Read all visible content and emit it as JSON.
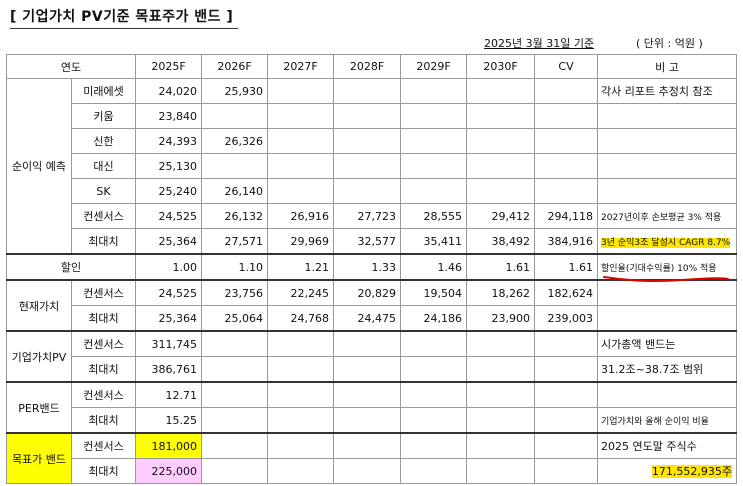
{
  "title": "[ 기업가치 PV기준 목표주가 밴드 ]",
  "base_date": "2025년 3월 31일 기준",
  "unit": "( 단위 : 억원 )",
  "headers": [
    "연도",
    "2025F",
    "2026F",
    "2027F",
    "2028F",
    "2029F",
    "2030F",
    "CV",
    "비 고"
  ],
  "net_income": {
    "group": "순이익 예측",
    "rows": [
      {
        "label": "미래에셋",
        "values": [
          "24,020",
          "25,930",
          "",
          "",
          "",
          "",
          ""
        ],
        "note": "각사 리포트 추정치 참조"
      },
      {
        "label": "키움",
        "values": [
          "23,840",
          "",
          "",
          "",
          "",
          "",
          ""
        ],
        "note": ""
      },
      {
        "label": "신한",
        "values": [
          "24,393",
          "26,326",
          "",
          "",
          "",
          "",
          ""
        ],
        "note": ""
      },
      {
        "label": "대신",
        "values": [
          "25,130",
          "",
          "",
          "",
          "",
          "",
          ""
        ],
        "note": ""
      },
      {
        "label": "SK",
        "values": [
          "25,240",
          "26,140",
          "",
          "",
          "",
          "",
          ""
        ],
        "note": ""
      },
      {
        "label": "컨센서스",
        "values": [
          "24,525",
          "26,132",
          "26,916",
          "27,723",
          "28,555",
          "29,412",
          "294,118"
        ],
        "note": "2027년이후 손보평균 3% 적용"
      },
      {
        "label": "최대치",
        "values": [
          "25,364",
          "27,571",
          "29,969",
          "32,577",
          "35,411",
          "38,492",
          "384,916"
        ],
        "note": "3년 순익3조 달성시 CAGR 8.7%"
      }
    ]
  },
  "discount": {
    "label": "할인",
    "values": [
      "1.00",
      "1.10",
      "1.21",
      "1.33",
      "1.46",
      "1.61",
      "1.61"
    ],
    "note": "할인율(기대수익률) 10% 적용"
  },
  "present_value": {
    "group": "현재가치",
    "rows": [
      {
        "label": "컨센서스",
        "values": [
          "24,525",
          "23,756",
          "22,245",
          "20,829",
          "19,504",
          "18,262",
          "182,624"
        ],
        "note": ""
      },
      {
        "label": "최대치",
        "values": [
          "25,364",
          "25,064",
          "24,768",
          "24,475",
          "24,186",
          "23,900",
          "239,003"
        ],
        "note": ""
      }
    ]
  },
  "enterprise_pv": {
    "group": "기업가치PV",
    "rows": [
      {
        "label": "컨센서스",
        "value": "311,745",
        "note": "시가총액 밴드는"
      },
      {
        "label": "최대치",
        "value": "386,761",
        "note": "31.2조~38.7조 범위"
      }
    ]
  },
  "per_band": {
    "group": "PER밴드",
    "rows": [
      {
        "label": "컨센서스",
        "value": "12.71",
        "note": ""
      },
      {
        "label": "최대치",
        "value": "15.25",
        "note": "기업가치와 올해 순이익 비율"
      }
    ]
  },
  "target_band": {
    "group": "목표가 밴드",
    "rows": [
      {
        "label": "컨센서스",
        "value": "181,000",
        "note": "2025 연도말 주식수"
      },
      {
        "label": "최대치",
        "value": "225,000",
        "note": "171,552,935주"
      }
    ]
  },
  "colors": {
    "yellow": "#ffff00",
    "pink": "#ffccff",
    "highlight": "#ffe600",
    "red_underline": "#e00000"
  }
}
